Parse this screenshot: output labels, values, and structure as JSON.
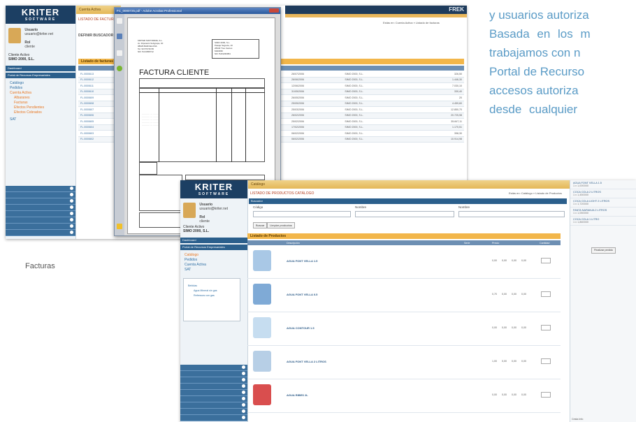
{
  "prose": {
    "lines": [
      "y usuarios autoriza",
      "Basada en los m",
      "trabajamos con n",
      "Portal de Recurso",
      "accesos autoriza",
      "desde cualquier"
    ]
  },
  "caption": "Facturas",
  "shot1": {
    "logo": "KRITER",
    "logo_sub": "SOFTWARE",
    "user_label": "Usuario",
    "user_email": "usuario@kriter.net",
    "role": "Rol",
    "role_value": "cliente",
    "client_label": "Cliente Activo",
    "client_value": "SIMO 2000, S.L.",
    "band_dashboard": "Dashboard",
    "band_portal": "Portal de Recursos Empresariales",
    "menu": [
      "Catálogo",
      "Pedidos",
      "Cuenta Activa",
      "Albaranes",
      "Facturas",
      "Efectos Pendientes",
      "Efectos Cobrados",
      "SAT"
    ],
    "topbar": "Cuenta Activa",
    "brand": "FREK",
    "subtitle": "LISTADO DE FACTURAS",
    "crumb": "Estás en: Cuenta Activa » Listado de facturas",
    "search_title": "DEFINIR BUSCADOR",
    "panel_title": "Listado de facturas",
    "rows": [
      "FL.0000613",
      "FL.0000612",
      "FL.0000611",
      "FL.0000610",
      "FL.0000609",
      "FL.0000608",
      "FL.0000607",
      "FL.0000606",
      "FL.0000605",
      "FL.0000604",
      "FL.0000603",
      "FL.0000602"
    ],
    "dates": [
      "26/07/2006",
      "26/06/2006",
      "12/06/2006",
      "31/05/2006",
      "26/05/2006",
      "25/05/2006",
      "25/03/2006",
      "26/02/2006",
      "25/02/2006",
      "17/02/2006",
      "06/02/2006",
      "06/02/2006"
    ],
    "client_col": "SIMO 2000, S.L.",
    "amounts": [
      "326,50",
      "1.446,30",
      "7.030,10",
      "330,40",
      "20",
      "4.459,60",
      "12.850,70",
      "20.725,98",
      "35.847,11",
      "1.170,51",
      "398,30",
      "10.914,98"
    ]
  },
  "pdf": {
    "title": "FC_0000725.pdf - Adobe Acrobat Professional",
    "heading": "FACTURA CLIENTE",
    "sender": [
      "KRITER SOFTWARE, S.L.",
      "Av. Diputació Subgrapa, 40",
      "08029 BARCELONA",
      "Tel. 93 870 50 86",
      "NIF: B-64658712"
    ],
    "recipient": [
      "SIMO 2000, S.L.",
      "Pasaje Segovia, 10",
      "28440 Tres Cantos",
      "MADRID",
      "NIF: B-84236954"
    ]
  },
  "shot2": {
    "topbar": "Catálogo",
    "subtitle": "LISTADO DE PRODUCTOS CATÁLOGO",
    "crumb": "Estás en: Catálogo » Listado de Productos",
    "search_bar": "Buscador",
    "label_code": "Código",
    "label_name": "Nombre",
    "label_name2": "Nombre",
    "btn_search": "Buscar",
    "btn_clear": "Limpiar productos",
    "panel_title": "Listado de Productos",
    "col_desc": "Descripción",
    "col_serie": "Serie",
    "col_price": "Precio",
    "col_qty": "Cantidad",
    "tree": [
      "Bebidas",
      "Agua Mineral sin gas",
      "Refrescos con gas"
    ],
    "products": [
      {
        "name": "AGUA FONT VELLA 1.5",
        "nums": "0,00 0,00 0,00 0,00"
      },
      {
        "name": "AGUA FONT VELLA 0.5",
        "nums": "0,70 0,00 0,00 0,00"
      },
      {
        "name": "AGUA CONTOUR 1.5",
        "nums": "0,00 0,00 0,00 0,00"
      },
      {
        "name": "AGUA FONT VELLA 2 LITROS",
        "nums": "1,00 0,00 0,00 0,00"
      },
      {
        "name": "AGUA RIBES 2L",
        "nums": "0,00 0,00 0,00 0,00"
      }
    ],
    "cart": [
      {
        "name": "AGUA FONT VELLA 1.5",
        "qty": "1 x 1,000000"
      },
      {
        "name": "COCA COLA 2 LITROS",
        "qty": "1 x 1,450000"
      },
      {
        "name": "COCA COLA LIGHT 2 LITROS",
        "qty": "1 x 1,720000"
      },
      {
        "name": "FANTA NARANJA 2 LITROS",
        "qty": "1 x 1,050000"
      },
      {
        "name": "COCA COLA 1 LITRO",
        "qty": "1 x 1,860000"
      }
    ],
    "cart_button": "Finalizar pedido",
    "cart_tab1": "Cesta",
    "cart_tab2": "Info"
  }
}
